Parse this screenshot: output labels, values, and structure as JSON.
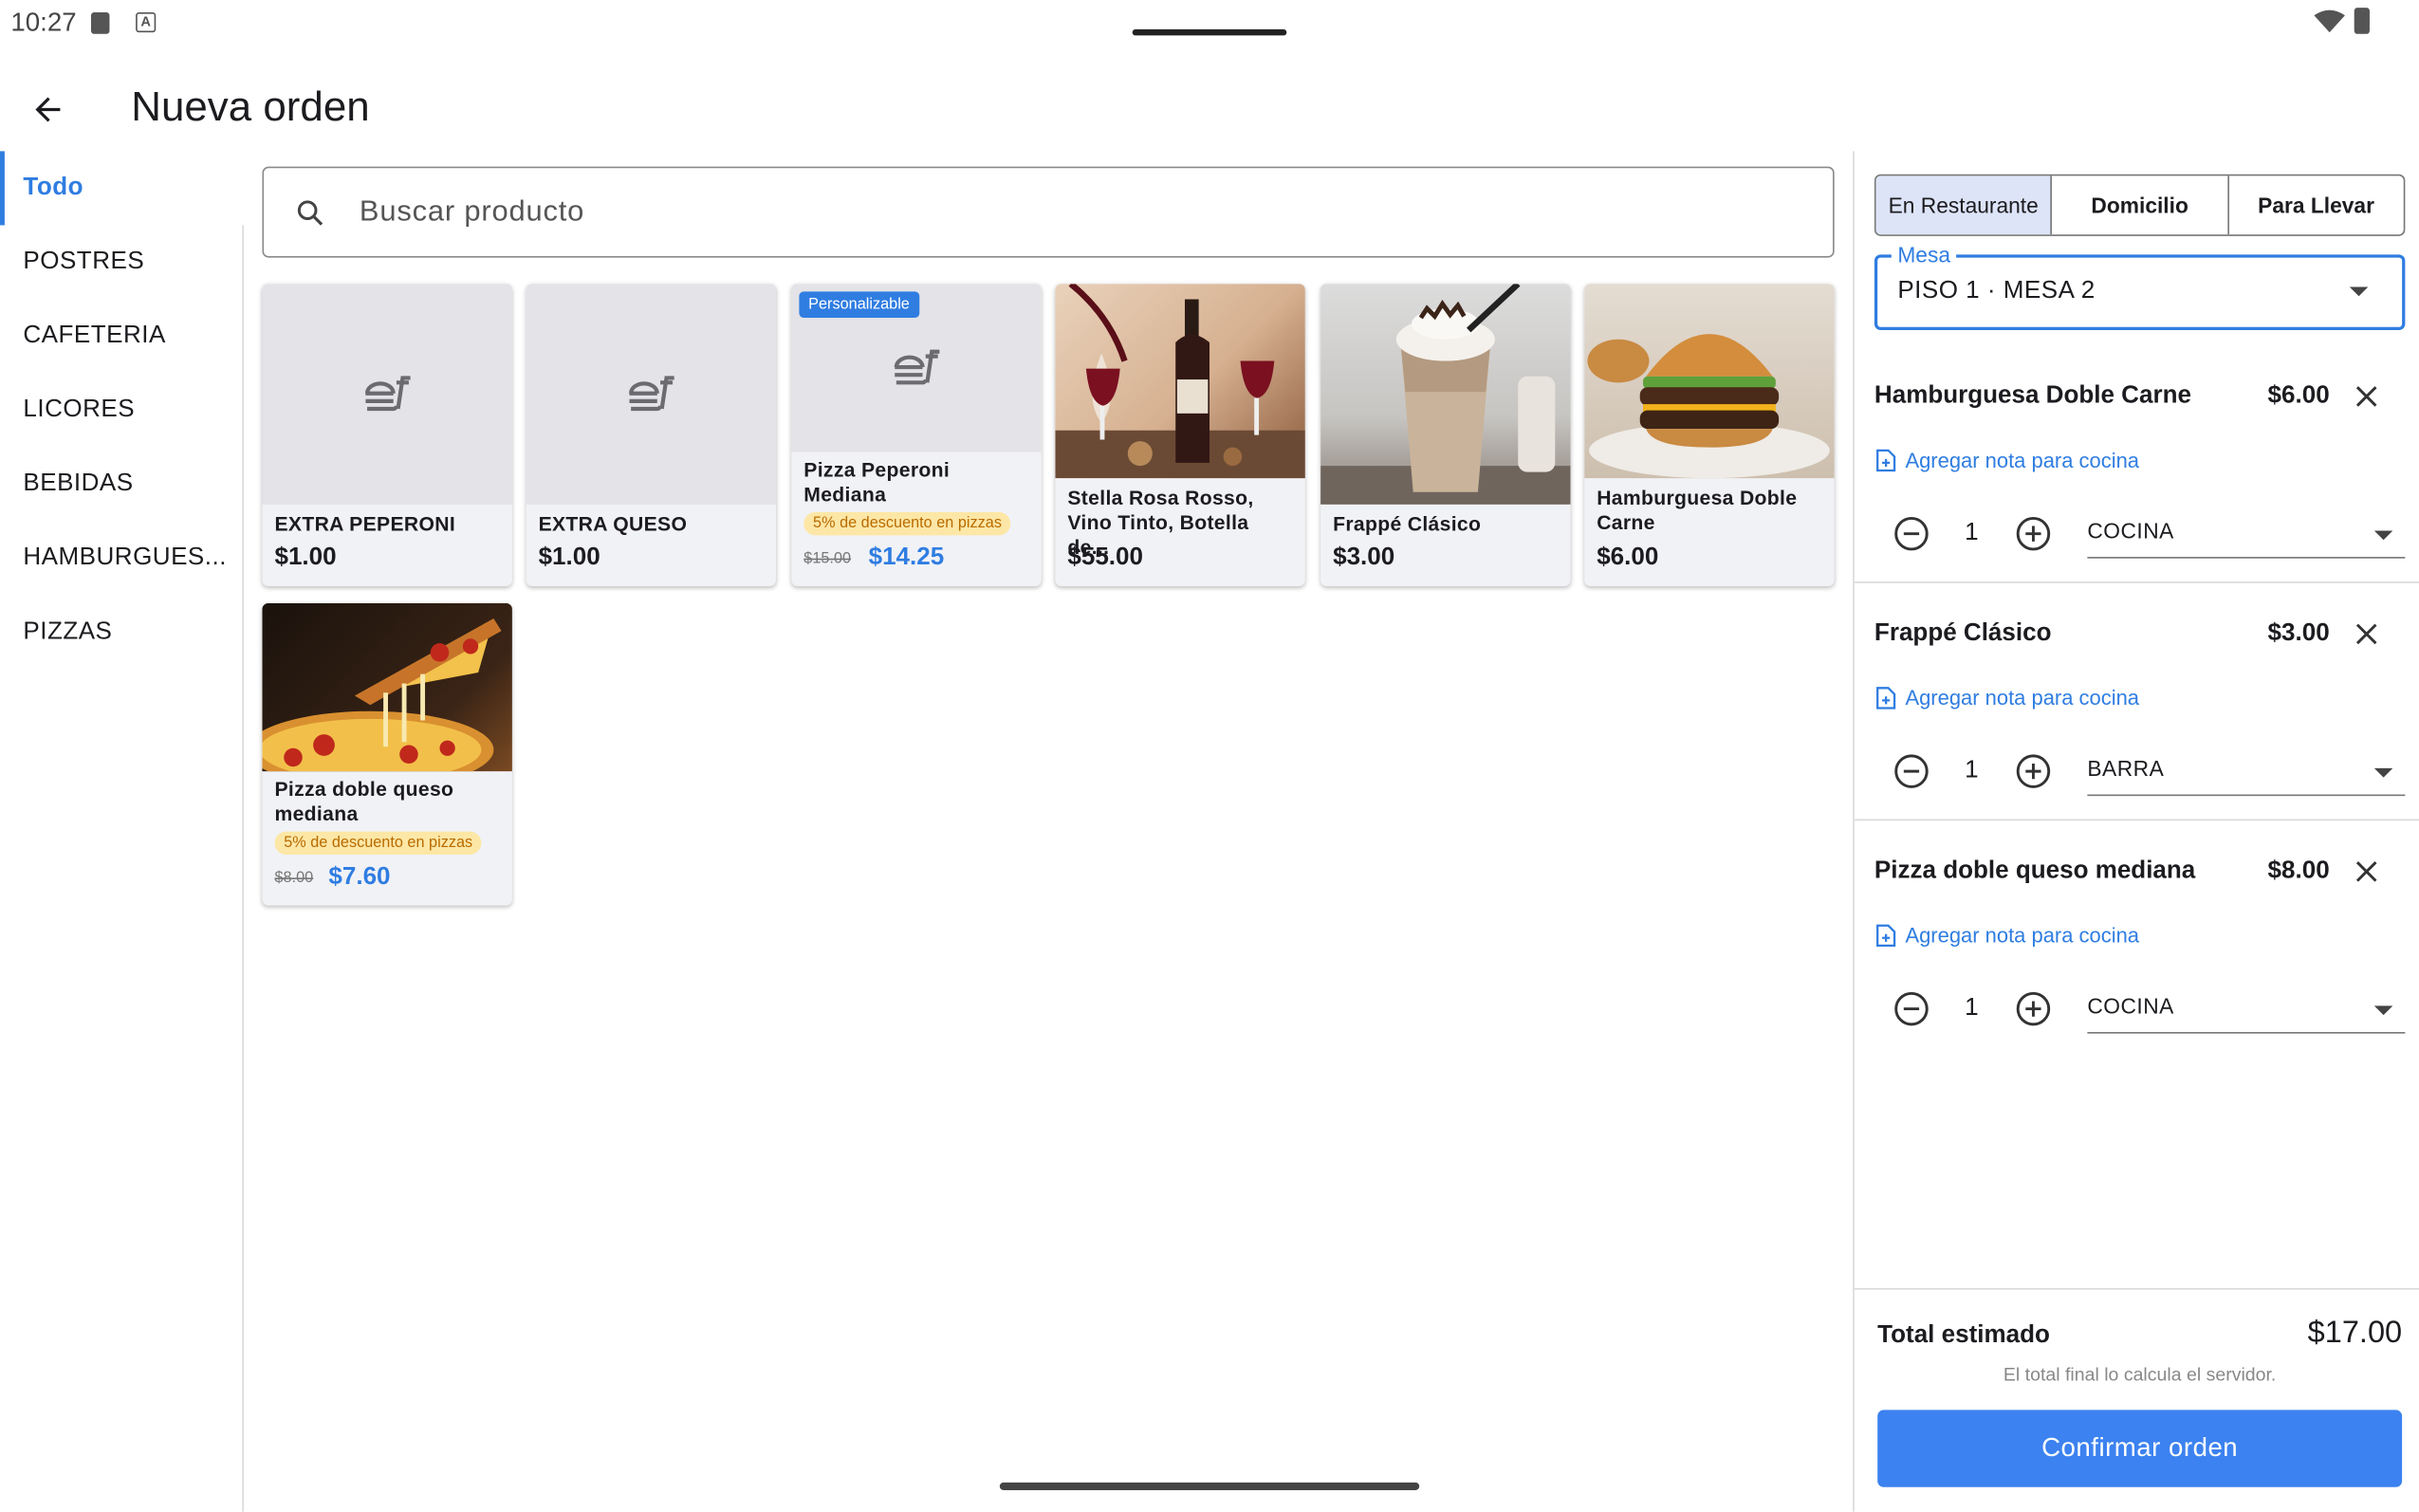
{
  "status_bar": {
    "time": "10:27"
  },
  "header": {
    "title": "Nueva orden"
  },
  "categories": [
    {
      "label": "Todo",
      "active": true
    },
    {
      "label": "POSTRES"
    },
    {
      "label": "CAFETERIA"
    },
    {
      "label": "LICORES"
    },
    {
      "label": "BEBIDAS"
    },
    {
      "label": "HAMBURGUES..."
    },
    {
      "label": "PIZZAS"
    }
  ],
  "search": {
    "placeholder": "Buscar producto"
  },
  "products": [
    {
      "name": "EXTRA PEPERONI",
      "price": "$1.00",
      "image": "food-placeholder-icon"
    },
    {
      "name": "EXTRA QUESO",
      "price": "$1.00",
      "image": "food-placeholder-icon"
    },
    {
      "name": "Pizza Peperoni Mediana",
      "badge": "Personalizable",
      "discount": "5% de descuento en pizzas",
      "old_price": "$15.00",
      "price": "$14.25",
      "image": "food-placeholder-icon"
    },
    {
      "name": "Stella Rosa Rosso, Vino Tinto, Botella de...",
      "price": "$55.00",
      "image": "wine-photo"
    },
    {
      "name": "Frappé Clásico",
      "price": "$3.00",
      "image": "frappe-photo"
    },
    {
      "name": "Hamburguesa Doble Carne",
      "price": "$6.00",
      "image": "burger-photo"
    },
    {
      "name": "Pizza doble queso mediana",
      "discount": "5% de descuento en pizzas",
      "old_price": "$8.00",
      "price": "$7.60",
      "image": "pizza-photo"
    }
  ],
  "order": {
    "types": [
      "En Restaurante",
      "Domicilio",
      "Para Llevar"
    ],
    "selected_type": "En Restaurante",
    "mesa_label": "Mesa",
    "mesa_value": "PISO 1 · MESA 2",
    "note_label": "Agregar nota para cocina",
    "items": [
      {
        "name": "Hamburguesa Doble Carne",
        "price": "$6.00",
        "qty": "1",
        "station": "COCINA"
      },
      {
        "name": "Frappé Clásico",
        "price": "$3.00",
        "qty": "1",
        "station": "BARRA"
      },
      {
        "name": "Pizza doble queso mediana",
        "price": "$8.00",
        "qty": "1",
        "station": "COCINA"
      }
    ],
    "total_label": "Total estimado",
    "total_value": "$17.00",
    "total_note": "El total final lo calcula el servidor.",
    "confirm_label": "Confirmar orden"
  },
  "colors": {
    "accent": "#2f7de1",
    "confirm": "#3c82f0",
    "discount_bg": "#fde7a6",
    "discount_text": "#b86b00",
    "selected_segment": "#dde4f7"
  }
}
